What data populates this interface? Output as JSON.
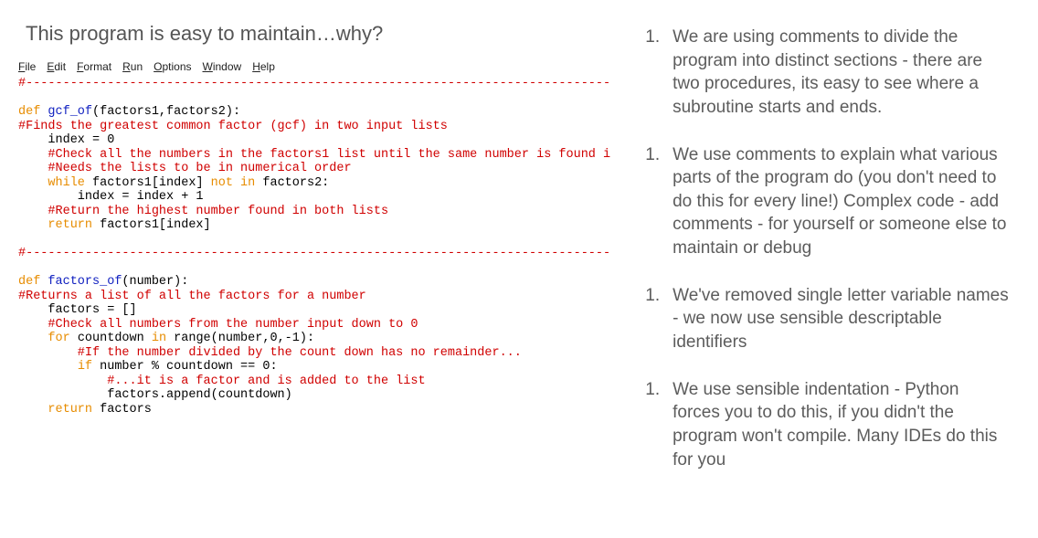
{
  "question": "This program is easy to maintain…why?",
  "ide_menu": [
    "File",
    "Edit",
    "Format",
    "Run",
    "Options",
    "Window",
    "Help"
  ],
  "code_lines": [
    {
      "segs": [
        {
          "cls": "c-comment",
          "t": "#-------------------------------------------------------------------------------"
        }
      ]
    },
    {
      "segs": [
        {
          "cls": "c-plain",
          "t": ""
        }
      ]
    },
    {
      "segs": [
        {
          "cls": "c-kw",
          "t": "def "
        },
        {
          "cls": "c-def",
          "t": "gcf_of"
        },
        {
          "cls": "c-plain",
          "t": "(factors1,factors2):"
        }
      ]
    },
    {
      "segs": [
        {
          "cls": "c-comment",
          "t": "#Finds the greatest common factor (gcf) in two input lists"
        }
      ]
    },
    {
      "segs": [
        {
          "cls": "c-plain",
          "t": "    index = 0"
        }
      ]
    },
    {
      "segs": [
        {
          "cls": "c-comment",
          "t": "    #Check all the numbers in the factors1 list until the same number is found i"
        }
      ]
    },
    {
      "segs": [
        {
          "cls": "c-comment",
          "t": "    #Needs the lists to be in numerical order"
        }
      ]
    },
    {
      "segs": [
        {
          "cls": "c-plain",
          "t": "    "
        },
        {
          "cls": "c-kw",
          "t": "while"
        },
        {
          "cls": "c-plain",
          "t": " factors1[index] "
        },
        {
          "cls": "c-kw",
          "t": "not in"
        },
        {
          "cls": "c-plain",
          "t": " factors2:"
        }
      ]
    },
    {
      "segs": [
        {
          "cls": "c-plain",
          "t": "        index = index + 1"
        }
      ]
    },
    {
      "segs": [
        {
          "cls": "c-comment",
          "t": "    #Return the highest number found in both lists"
        }
      ]
    },
    {
      "segs": [
        {
          "cls": "c-plain",
          "t": "    "
        },
        {
          "cls": "c-kw",
          "t": "return"
        },
        {
          "cls": "c-plain",
          "t": " factors1[index]"
        }
      ]
    },
    {
      "segs": [
        {
          "cls": "c-plain",
          "t": ""
        }
      ]
    },
    {
      "segs": [
        {
          "cls": "c-comment",
          "t": "#-------------------------------------------------------------------------------"
        }
      ]
    },
    {
      "segs": [
        {
          "cls": "c-plain",
          "t": ""
        }
      ]
    },
    {
      "segs": [
        {
          "cls": "c-kw",
          "t": "def "
        },
        {
          "cls": "c-def",
          "t": "factors_of"
        },
        {
          "cls": "c-plain",
          "t": "(number):"
        }
      ]
    },
    {
      "segs": [
        {
          "cls": "c-comment",
          "t": "#Returns a list of all the factors for a number"
        }
      ]
    },
    {
      "segs": [
        {
          "cls": "c-plain",
          "t": "    factors = []"
        }
      ]
    },
    {
      "segs": [
        {
          "cls": "c-comment",
          "t": "    #Check all numbers from the number input down to 0"
        }
      ]
    },
    {
      "segs": [
        {
          "cls": "c-plain",
          "t": "    "
        },
        {
          "cls": "c-kw",
          "t": "for"
        },
        {
          "cls": "c-plain",
          "t": " countdown "
        },
        {
          "cls": "c-kw",
          "t": "in"
        },
        {
          "cls": "c-plain",
          "t": " range(number,0,-1):"
        }
      ]
    },
    {
      "segs": [
        {
          "cls": "c-comment",
          "t": "        #If the number divided by the count down has no remainder..."
        }
      ]
    },
    {
      "segs": [
        {
          "cls": "c-plain",
          "t": "        "
        },
        {
          "cls": "c-kw",
          "t": "if"
        },
        {
          "cls": "c-plain",
          "t": " number % countdown == 0:"
        }
      ]
    },
    {
      "segs": [
        {
          "cls": "c-comment",
          "t": "            #...it is a factor and is added to the list"
        }
      ]
    },
    {
      "segs": [
        {
          "cls": "c-plain",
          "t": "            factors.append(countdown)"
        }
      ]
    },
    {
      "segs": [
        {
          "cls": "c-plain",
          "t": "    "
        },
        {
          "cls": "c-kw",
          "t": "return"
        },
        {
          "cls": "c-plain",
          "t": " factors"
        }
      ]
    }
  ],
  "bullets": [
    {
      "num": "1.",
      "text": "We are using comments to divide the program into distinct sections - there are two procedures, its easy to see where a subroutine starts and ends."
    },
    {
      "num": "1.",
      "text": "We use comments to explain what various parts of the program do (you don't need to do this for every line!) Complex code - add comments - for yourself or someone else to maintain or debug"
    },
    {
      "num": "1.",
      "text": "We've removed single letter variable names - we now use sensible descriptable identifiers"
    },
    {
      "num": "1.",
      "text": "We use sensible indentation - Python forces you to do this, if you didn't the program won't compile. Many IDEs do this for you"
    }
  ]
}
